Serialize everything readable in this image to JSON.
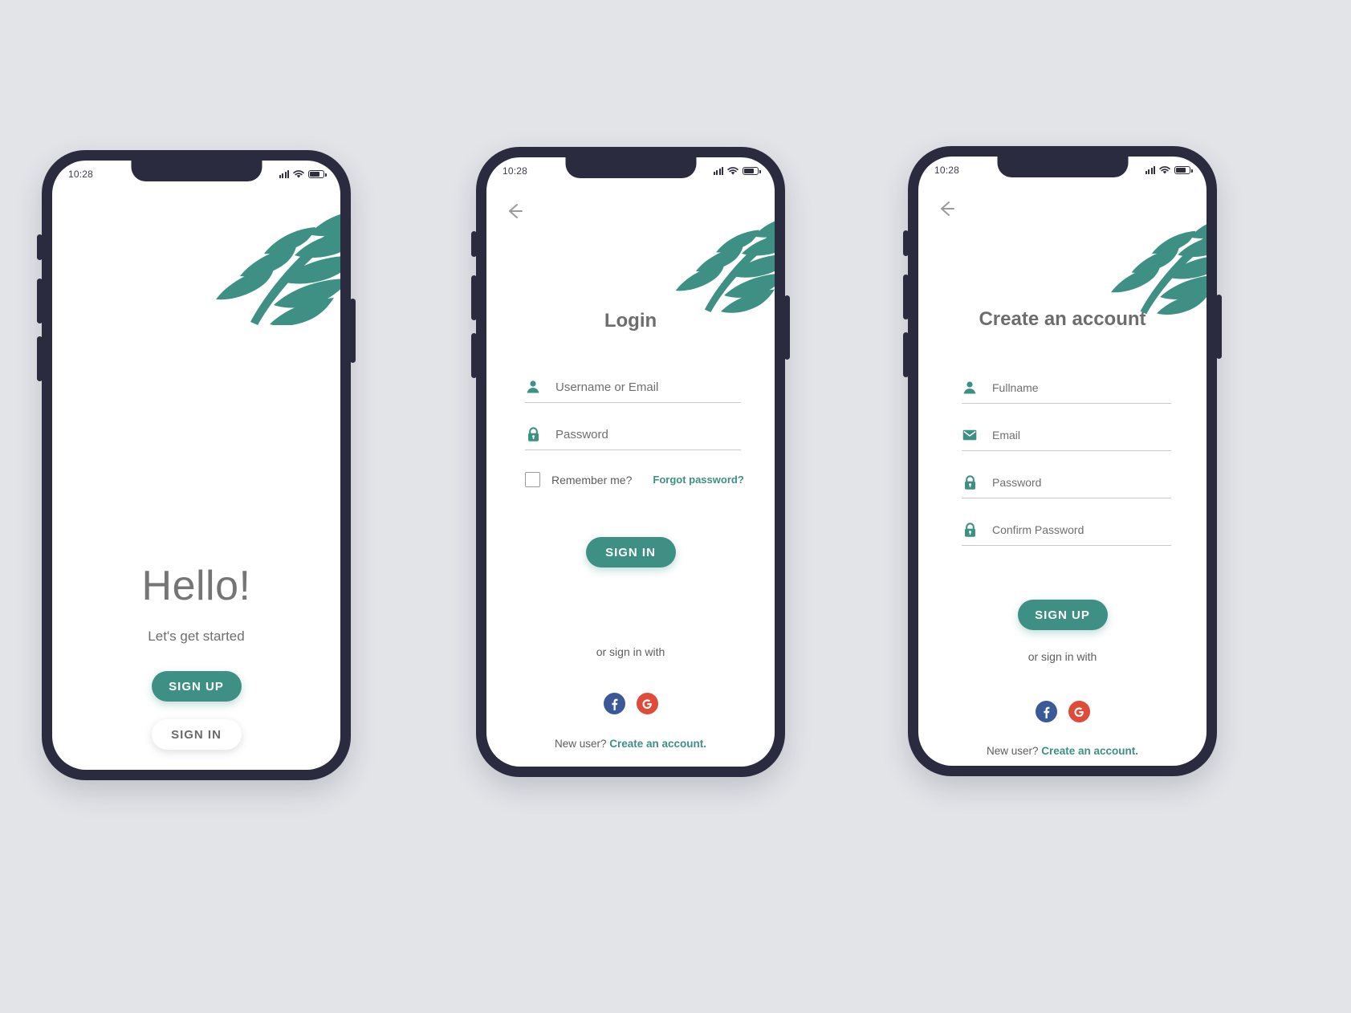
{
  "theme": {
    "accent": "#3d9083",
    "frame": "#2b2b3f",
    "background": "#e2e4e8",
    "facebook_blue": "#3b5998",
    "google_red": "#de4b39",
    "text_gray": "#6f6f6f"
  },
  "status_bar": {
    "time": "10:28",
    "signal_icon": "signal-bars-icon",
    "wifi_icon": "wifi-icon",
    "battery_icon": "battery-icon"
  },
  "screens": [
    {
      "id": "welcome",
      "name": "Welcome",
      "heading": "Hello!",
      "subtitle": "Let's get started",
      "primary_button": "SIGN UP",
      "secondary_button": "SIGN IN",
      "leaf_icon": "palm-leaf-icon"
    },
    {
      "id": "login",
      "name": "Login",
      "back_icon": "back-arrow-icon",
      "title": "Login",
      "fields": [
        {
          "icon": "person-icon",
          "placeholder": "Username or Email"
        },
        {
          "icon": "lock-icon",
          "placeholder": "Password"
        }
      ],
      "remember_label": "Remember me?",
      "remember_checked": false,
      "forgot_label": "Forgot password?",
      "submit_button": "SIGN IN",
      "or_text": "or sign in with",
      "socials": [
        {
          "icon": "facebook-icon",
          "label": "f"
        },
        {
          "icon": "google-icon",
          "label": "G"
        }
      ],
      "footer_text": "New user? ",
      "footer_link": "Create an account."
    },
    {
      "id": "signup",
      "name": "Create an account",
      "back_icon": "back-arrow-icon",
      "title": "Create an account",
      "fields": [
        {
          "icon": "person-icon",
          "placeholder": "Fullname"
        },
        {
          "icon": "envelope-icon",
          "placeholder": "Email"
        },
        {
          "icon": "lock-icon",
          "placeholder": "Password"
        },
        {
          "icon": "lock-icon",
          "placeholder": "Confirm Password"
        }
      ],
      "submit_button": "SIGN UP",
      "or_text": "or sign in with",
      "socials": [
        {
          "icon": "facebook-icon",
          "label": "f"
        },
        {
          "icon": "google-icon",
          "label": "G"
        }
      ],
      "footer_text": "New user? ",
      "footer_link": "Create an account."
    }
  ]
}
